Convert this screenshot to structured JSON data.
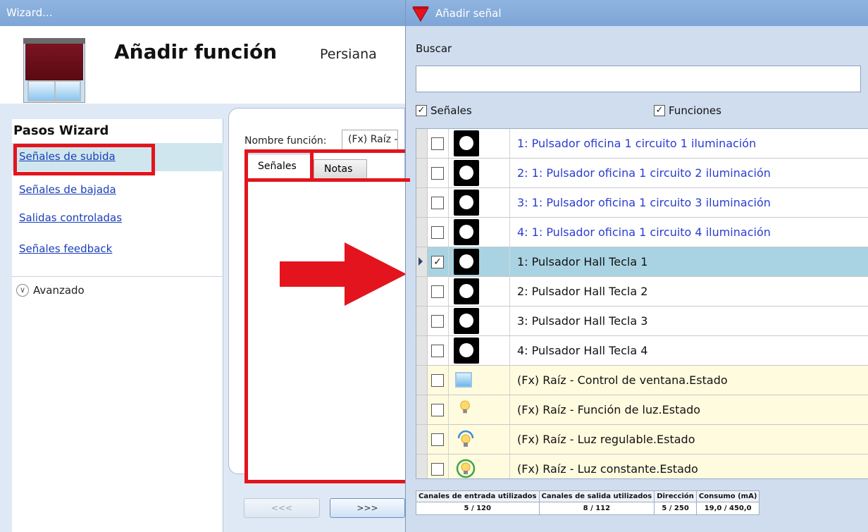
{
  "wizard": {
    "window_title": "Wizard...",
    "title": "Añadir función",
    "subtitle": "Persiana",
    "steps_title": "Pasos Wizard",
    "steps": [
      {
        "label": "Señales de subida"
      },
      {
        "label": "Señales de bajada"
      },
      {
        "label": "Salidas controladas"
      },
      {
        "label": "Señales feedback"
      }
    ],
    "advanced_label": "Avanzado",
    "function_name_label": "Nombre función:",
    "function_name_value": "(Fx) Raíz - ",
    "tabs": [
      {
        "label": "Señales"
      },
      {
        "label": "Notas"
      }
    ],
    "prev_button": "<<<",
    "next_button": ">>>"
  },
  "dialog": {
    "title": "Añadir señal",
    "search_label": "Buscar",
    "search_value": "",
    "filters": [
      {
        "label": "Señales",
        "checked": true
      },
      {
        "label": "Funciones",
        "checked": true
      }
    ],
    "rows": [
      {
        "label": "1: Pulsador oficina 1 circuito 1 iluminación",
        "checked": false,
        "icon": "pushbutton-icon"
      },
      {
        "label": "2: 1: Pulsador oficina 1 circuito 2 iluminación",
        "checked": false,
        "icon": "pushbutton-icon"
      },
      {
        "label": "3: 1: Pulsador oficina 1 circuito 3 iluminación",
        "checked": false,
        "icon": "pushbutton-icon"
      },
      {
        "label": "4: 1: Pulsador oficina 1 circuito 4 iluminación",
        "checked": false,
        "icon": "pushbutton-icon"
      },
      {
        "label": "1: Pulsador Hall Tecla 1",
        "checked": true,
        "icon": "pushbutton-icon"
      },
      {
        "label": "2: Pulsador Hall Tecla 2",
        "checked": false,
        "icon": "pushbutton-icon"
      },
      {
        "label": "3: Pulsador Hall Tecla 3",
        "checked": false,
        "icon": "pushbutton-icon"
      },
      {
        "label": "4: Pulsador Hall Tecla 4",
        "checked": false,
        "icon": "pushbutton-icon"
      },
      {
        "label": "(Fx) Raíz - Control de ventana.Estado",
        "checked": false,
        "icon": "window-icon"
      },
      {
        "label": "(Fx) Raíz - Función de luz.Estado",
        "checked": false,
        "icon": "light-bulb-icon"
      },
      {
        "label": "(Fx) Raíz - Luz regulable.Estado",
        "checked": false,
        "icon": "dimmable-light-icon"
      },
      {
        "label": "(Fx) Raíz - Luz constante.Estado",
        "checked": false,
        "icon": "constant-light-icon"
      }
    ],
    "footer": {
      "headers": [
        "Canales de entrada utilizados",
        "Canales de salida utilizados",
        "Dirección",
        "Consumo (mA)"
      ],
      "values": [
        "5 / 120",
        "8 / 112",
        "5 / 250",
        "19,0 / 450,0"
      ]
    }
  },
  "colors": {
    "highlight_red": "#e3141d",
    "link_blue": "#1a3fb8",
    "selected_row": "#a9d3e2",
    "fx_row": "#fffbdf"
  }
}
